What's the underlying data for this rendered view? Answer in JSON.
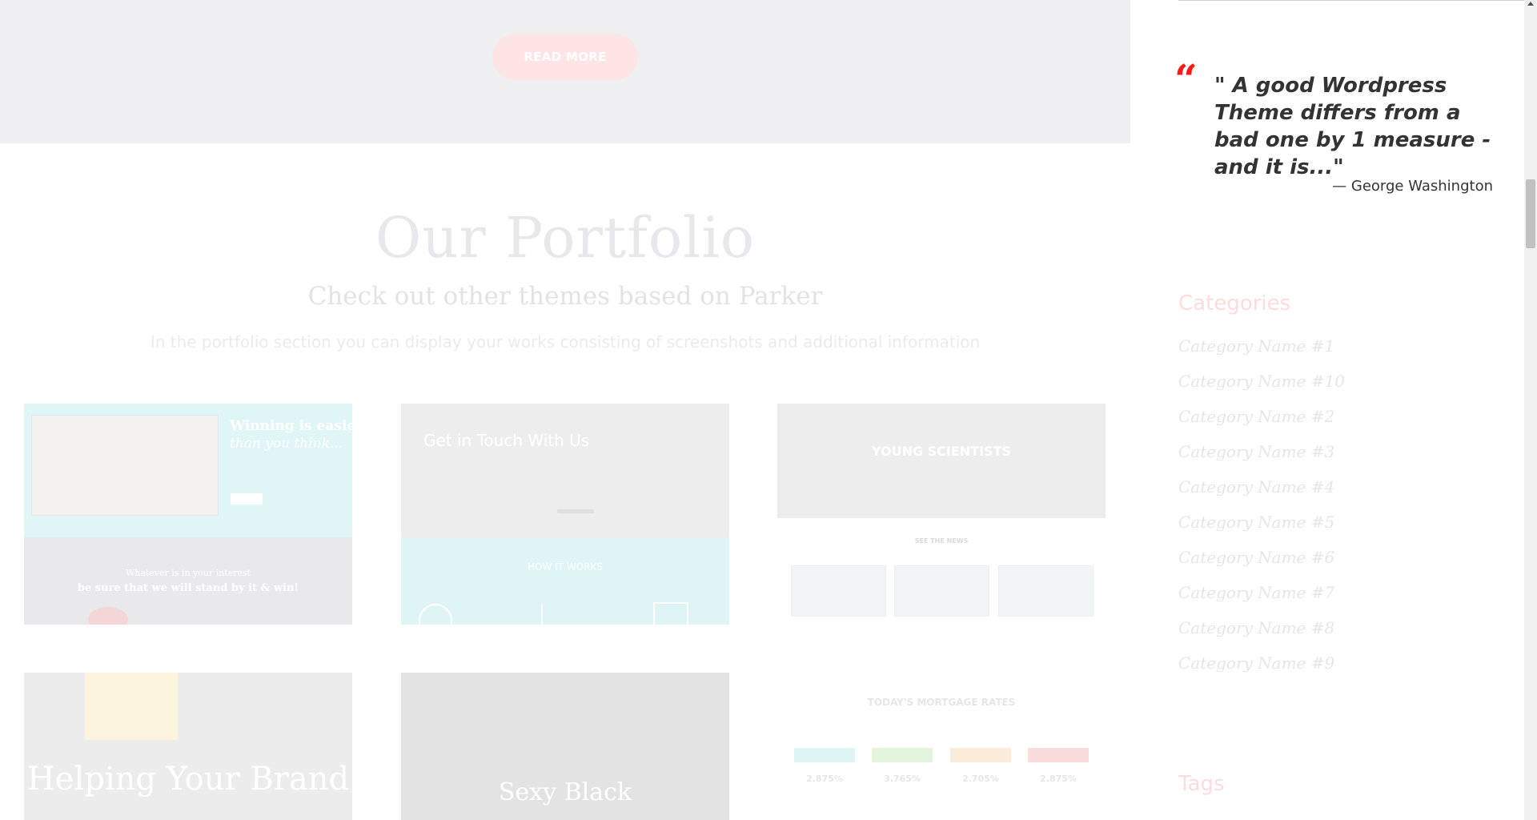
{
  "hero": {
    "read_more_label": "READ MORE"
  },
  "portfolio": {
    "title": "Our Portfolio",
    "subtitle": "Check out other themes based on Parker",
    "description": "In the portfolio section you can display your works consisting of screenshots and additional information",
    "tiles": [
      {
        "headline_1": "Winning is easier",
        "headline_2": "than you think...",
        "quote_1": "Whatever is in your interest",
        "quote_2": "be sure that we will stand by it & win!"
      },
      {
        "headline": "Get in Touch With Us",
        "sub": "HOW IT WORKS"
      },
      {
        "headline": "YOUNG SCIENTISTS",
        "news": "SEE THE NEWS"
      },
      {
        "headline": "Helping Your Brand"
      },
      {
        "headline": "Sexy Black"
      },
      {
        "headline": "TODAY'S MORTGAGE RATES",
        "rates": [
          "2.875%",
          "3.765%",
          "2.705%",
          "2.875%"
        ]
      }
    ]
  },
  "sidebar": {
    "quote_mark": "“",
    "quote": "\" A good Wordpress Theme differs from a bad one by 1 measure - and it is...\"",
    "author": "— George Washington",
    "categories_title": "Categories",
    "categories": [
      "Category Name #1",
      "Category Name #10",
      "Category Name #2",
      "Category Name #3",
      "Category Name #4",
      "Category Name #5",
      "Category Name #6",
      "Category Name #7",
      "Category Name #8",
      "Category Name #9"
    ],
    "tags_title": "Tags"
  },
  "colors": {
    "accent": "#ff1a1a",
    "read_more_bg": "#fde5e6",
    "text_dark": "#333333"
  }
}
